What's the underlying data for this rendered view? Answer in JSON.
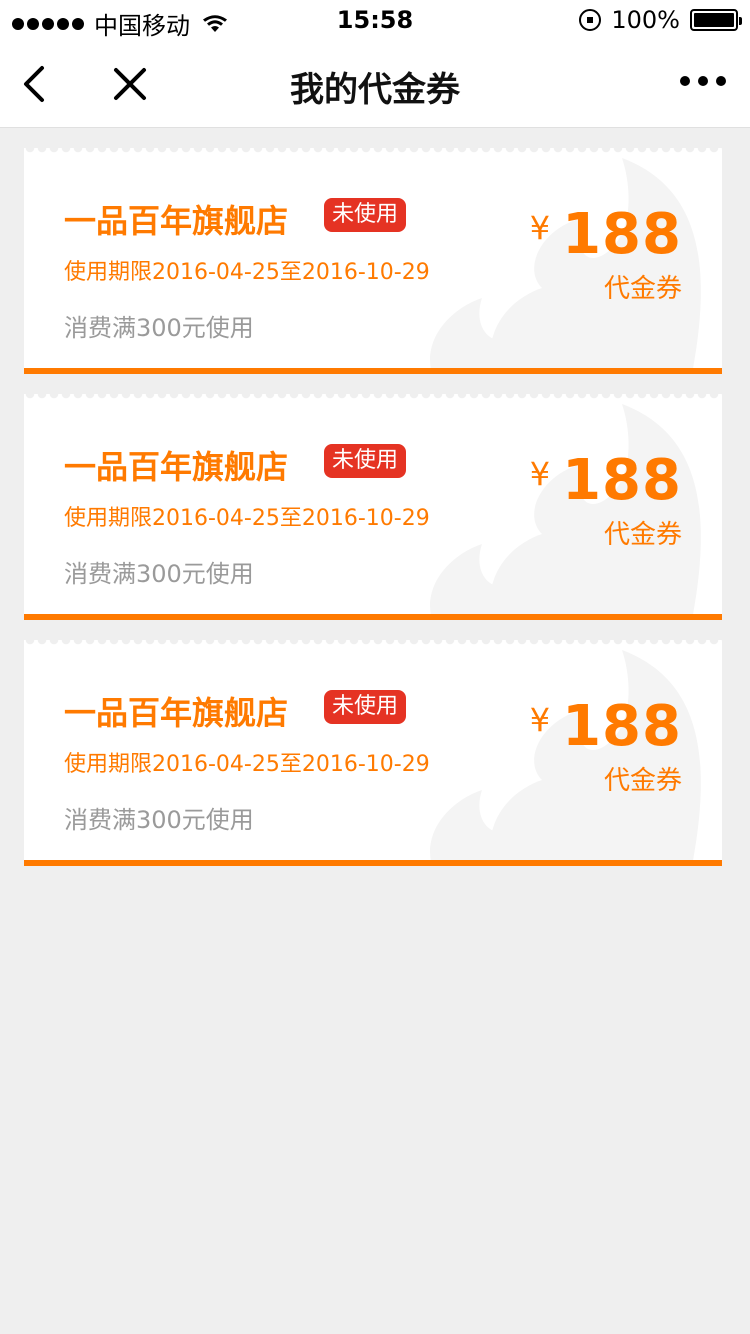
{
  "status_bar": {
    "carrier": "中国移动",
    "time": "15:58",
    "battery": "100%"
  },
  "nav": {
    "title": "我的代金券"
  },
  "coupons": [
    {
      "store": "一品百年旗舰店",
      "badge": "未使用",
      "period": "使用期限2016-04-25至2016-10-29",
      "condition": "消费满300元使用",
      "currency": "¥",
      "amount": "188",
      "unit": "代金券"
    },
    {
      "store": "一品百年旗舰店",
      "badge": "未使用",
      "period": "使用期限2016-04-25至2016-10-29",
      "condition": "消费满300元使用",
      "currency": "¥",
      "amount": "188",
      "unit": "代金券"
    },
    {
      "store": "一品百年旗舰店",
      "badge": "未使用",
      "period": "使用期限2016-04-25至2016-10-29",
      "condition": "消费满300元使用",
      "currency": "¥",
      "amount": "188",
      "unit": "代金券"
    }
  ],
  "colors": {
    "accent": "#ff7a00",
    "badge": "#e53323",
    "muted": "#9a9a9a",
    "background": "#efefef"
  }
}
